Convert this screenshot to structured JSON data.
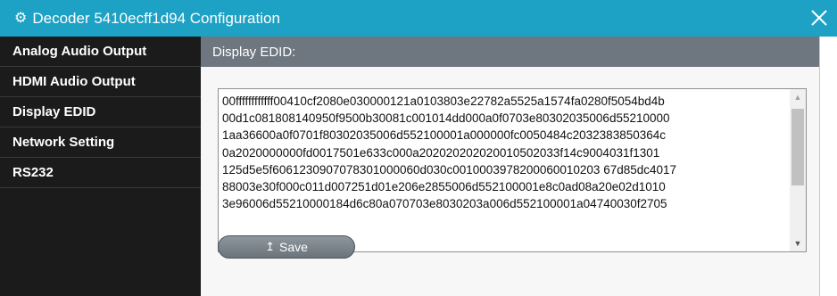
{
  "window": {
    "title": "Decoder 5410ecff1d94 Configuration",
    "title_icon": "gear-icon",
    "close_icon": "close-icon"
  },
  "sidebar": {
    "items": [
      {
        "label": "Analog Audio Output"
      },
      {
        "label": "HDMI Audio Output"
      },
      {
        "label": "Display EDID"
      },
      {
        "label": "Network Setting"
      },
      {
        "label": "RS232"
      }
    ]
  },
  "main": {
    "header": "Display EDID:",
    "edid_text": "00ffffffffffff00410cf2080e030000121a0103803e22782a5525a1574fa0280f5054bd4b\n00d1c081808140950f9500b30081c001014dd000a0f0703e80302035006d55210000\n1aa36600a0f0701f80302035006d552100001a000000fc0050484c2032383850364c\n0a2020000000fd0017501e633c000a202020202020010502033f14c9004031f1301\n125d5e5f6061230907078301000060d030c0010003978200060010203 67d85dc4017\n88003e30f000c011d007251d01e206e2855006d552100001e8c0ad08a20e02d1010\n3e96006d55210000184d6c80a070703e8030203a006d552100001a04740030f2705\n",
    "save_label": "Save",
    "save_icon": "upload-icon"
  }
}
